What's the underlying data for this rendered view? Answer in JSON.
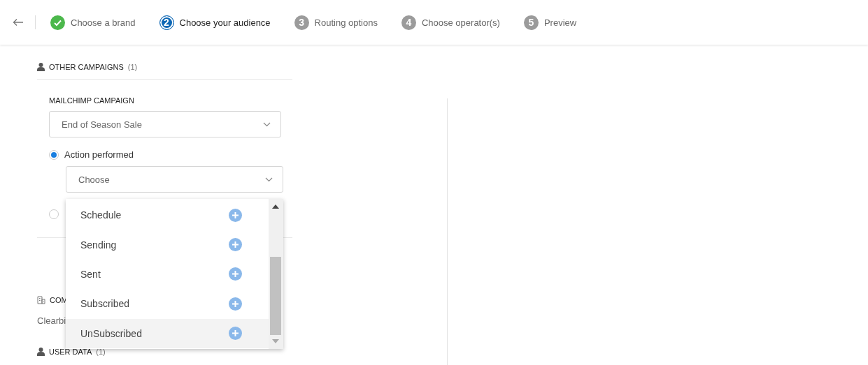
{
  "steps": [
    {
      "completed": true,
      "selected": false,
      "label": "Choose a brand"
    },
    {
      "completed": false,
      "selected": true,
      "number": "2",
      "label": "Choose your audience"
    },
    {
      "completed": false,
      "selected": false,
      "number": "3",
      "label": "Routing options"
    },
    {
      "completed": false,
      "selected": false,
      "number": "4",
      "label": "Choose operator(s)"
    },
    {
      "completed": false,
      "selected": false,
      "number": "5",
      "label": "Preview"
    }
  ],
  "other_campaigns": {
    "title": "OTHER CAMPAIGNS",
    "count": "(1)",
    "field_label": "MAILCHIMP CAMPAIGN",
    "campaign_select": {
      "value": "End of Season Sale"
    },
    "options": [
      {
        "label": "Action performed",
        "checked": true,
        "select": {
          "value": "Choose"
        }
      },
      {
        "checked": false
      }
    ]
  },
  "company_section": {
    "title": "COM",
    "value": "Clearbi"
  },
  "user_data": {
    "title": "USER DATA",
    "count": "(1)"
  },
  "action_menu": {
    "items": [
      {
        "label": "Schedule",
        "selected": false
      },
      {
        "label": "Sending",
        "selected": false
      },
      {
        "label": "Sent",
        "selected": false
      },
      {
        "label": "Subscribed",
        "selected": false
      },
      {
        "label": "UnSubscribed",
        "selected": true
      }
    ]
  }
}
